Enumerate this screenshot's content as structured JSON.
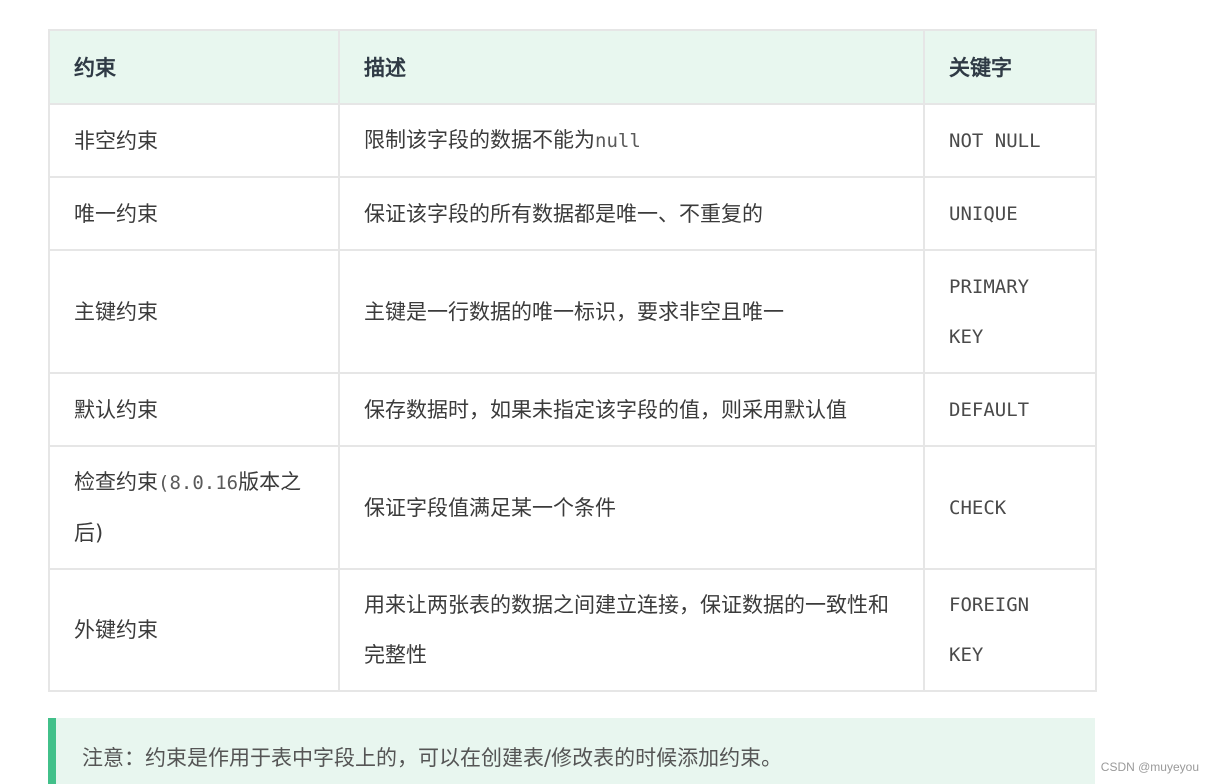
{
  "table": {
    "headers": [
      "约束",
      "描述",
      "关键字"
    ],
    "rows": [
      {
        "name": "非空约束",
        "desc_text": "限制该字段的数据不能为",
        "desc_code": "null",
        "keyword": "NOT NULL"
      },
      {
        "name": "唯一约束",
        "desc_text": "保证该字段的所有数据都是唯一、不重复的",
        "keyword": "UNIQUE"
      },
      {
        "name": "主键约束",
        "desc_text": "主键是一行数据的唯一标识，要求非空且唯一",
        "keyword": "PRIMARY KEY"
      },
      {
        "name": "默认约束",
        "desc_text": "保存数据时，如果未指定该字段的值，则采用默认值",
        "keyword": "DEFAULT"
      },
      {
        "name_text": "检查约束",
        "name_note": "(8.0.16",
        "name_rest": "版本之后)",
        "desc_text": "保证字段值满足某一个条件",
        "keyword": "CHECK"
      },
      {
        "name": "外键约束",
        "desc_text": "用来让两张表的数据之间建立连接，保证数据的一致性和完整性",
        "keyword": "FOREIGN KEY"
      }
    ]
  },
  "note": {
    "text": "注意：约束是作用于表中字段上的，可以在创建表/修改表的时候添加约束。",
    "border_color": "#42c08a",
    "background": "#e8f6ef"
  },
  "header_background": "#e8f7ef",
  "watermark": "CSDN @muyeyou"
}
